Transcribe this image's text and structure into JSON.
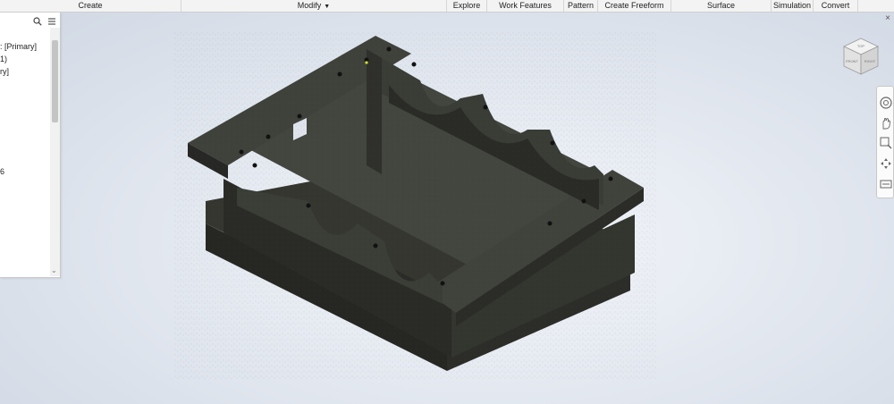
{
  "ribbon": {
    "groups": [
      {
        "label": "Create"
      },
      {
        "label": "Modify"
      },
      {
        "label": "Explore"
      },
      {
        "label": "Work Features"
      },
      {
        "label": "Pattern"
      },
      {
        "label": "Create Freeform"
      },
      {
        "label": "Surface"
      },
      {
        "label": "Simulation"
      },
      {
        "label": "Convert"
      }
    ]
  },
  "browser": {
    "tree_rows": [
      {
        "text": ": [Primary]"
      },
      {
        "text": "1)"
      },
      {
        "text": "ry]"
      },
      {
        "text": "6"
      }
    ]
  },
  "viewcube": {
    "top_face": "TOP",
    "front_face": "FRONT",
    "right_face": "RIGHT"
  },
  "colors": {
    "background": "#dde3ec",
    "model_top": "#3b3d3a",
    "model_side": "#2b2c2a",
    "ribbon": "#f3f3f3"
  }
}
